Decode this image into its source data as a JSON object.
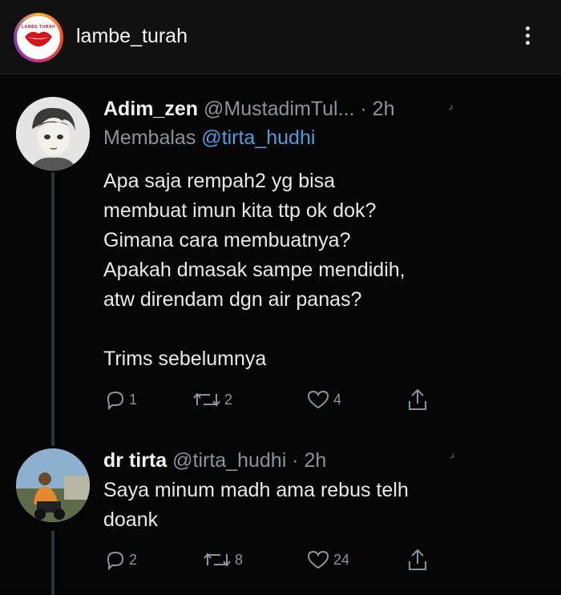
{
  "header": {
    "username": "lambe_turah",
    "avatar_text": "LAMBE TURAH"
  },
  "tweets": [
    {
      "name": "Adim_zen",
      "handle": "@MustadimTul...",
      "time": "· 2h",
      "reply_prefix": "Membalas",
      "reply_to": "@tirta_hudhi",
      "text": "Apa saja rempah2 yg bisa\nmembuat imun kita ttp ok dok?\nGimana cara membuatnya?\nApakah dmasak sampe mendidih,\natw direndam dgn air panas?\n\nTrims sebelumnya",
      "replies": "1",
      "retweets": "2",
      "likes": "4"
    },
    {
      "name": "dr tirta",
      "handle": "@tirta_hudhi",
      "time": "· 2h",
      "text": "Saya minum madh ama rebus telh\ndoank",
      "replies": "2",
      "retweets": "8",
      "likes": "24"
    }
  ],
  "colors": {
    "background": "#000000",
    "handle_gray": "#8b949b",
    "mention_blue": "#4a9fdf"
  }
}
